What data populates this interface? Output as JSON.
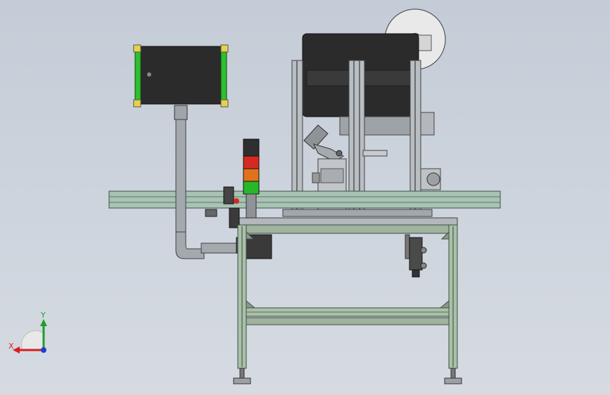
{
  "axes": {
    "x_label": "X",
    "y_label": "Y",
    "x_color": "#d81e1e",
    "y_color": "#1e9e2a",
    "z_color": "#1f3fd0"
  },
  "colors": {
    "background": "#ccd3dc",
    "frame": "#9ab09a",
    "frame_dark": "#5e6e60",
    "enclosure": "#2b2b2b",
    "enclosure_trim": "#2fbf2f",
    "corner": "#e6d24a",
    "conveyor": "#a8c2b4",
    "stack_red": "#d62a20",
    "stack_orange": "#e0721c",
    "stack_green": "#27b82a",
    "metal": "#b9bdc2",
    "metal_dark": "#6a6e73"
  },
  "icons": {
    "triad": "coordinate-triad-icon"
  }
}
